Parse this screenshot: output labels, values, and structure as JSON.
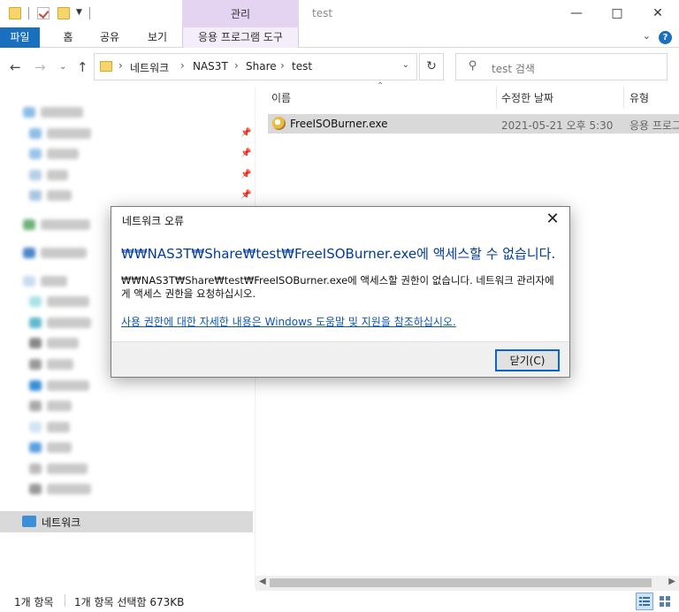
{
  "title_bar": {
    "context_tab_label": "관리",
    "window_title": "test",
    "minimize_icon": "minimize-icon",
    "maximize_icon": "maximize-icon",
    "close_icon": "close-icon"
  },
  "ribbon": {
    "tabs": [
      "파일",
      "홈",
      "공유",
      "보기"
    ],
    "context_tab": "응용 프로그램 도구",
    "file_tab_color": "#1a6fbf",
    "context_color": "#e4d3f1"
  },
  "address_bar": {
    "crumbs": [
      "네트워크",
      "NAS3T",
      "Share",
      "test"
    ],
    "search_placeholder": "test 검색"
  },
  "columns": {
    "name": "이름",
    "date": "수정한 날짜",
    "type": "유형"
  },
  "files": [
    {
      "name": "FreeISOBurner.exe",
      "date": "2021-05-21 오후 5:30",
      "type": "응용 프로그램"
    }
  ],
  "nav_pane": {
    "selected_item": "네트워크"
  },
  "status_bar": {
    "item_count": "1개 항목",
    "selection": "1개 항목 선택함 673KB"
  },
  "dialog": {
    "title": "네트워크 오류",
    "headline": "₩₩NAS3T₩Share₩test₩FreeISOBurner.exe에 액세스할 수 없습니다.",
    "body_line1": "₩₩NAS3T₩Share₩test₩FreeISOBurner.exe에 액세스할 권한이 없습니다. 네트워크 관리자에",
    "body_line2": "게 액세스 권한을 요청하십시오.",
    "link": "사용 권한에 대한 자세한 내용은 Windows 도움말 및 지원을 참조하십시오.",
    "close_button": "닫기(C)",
    "headline_color": "#003b9c"
  }
}
